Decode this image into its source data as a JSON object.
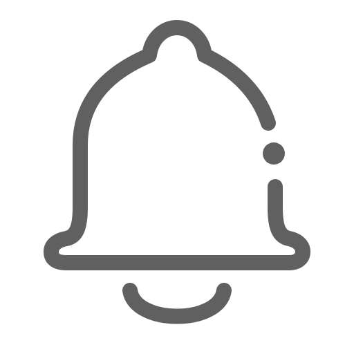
{
  "icon": {
    "name": "bell-icon",
    "style": "outline",
    "stroke_color": "#606060",
    "background_color": "#ffffff"
  }
}
